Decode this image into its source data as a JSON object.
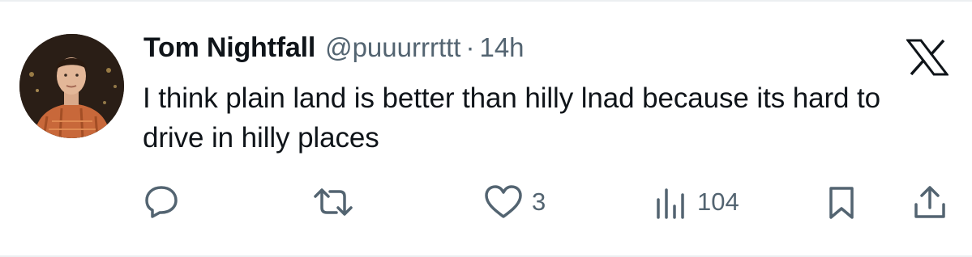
{
  "tweet": {
    "author_name": "Tom Nightfall",
    "handle": "@puuurrrttt",
    "separator": "·",
    "time": "14h",
    "text": "I think plain land is better than hilly lnad because its hard to drive in hilly places"
  },
  "actions": {
    "reply_count": "",
    "retweet_count": "",
    "like_count": "3",
    "views_count": "104"
  },
  "icons": {
    "logo": "x-logo-icon",
    "reply": "speech-bubble-icon",
    "retweet": "retweet-arrows-icon",
    "like": "heart-icon",
    "views": "bar-chart-icon",
    "bookmark": "bookmark-icon",
    "share": "share-upload-icon"
  },
  "colors": {
    "text_primary": "#0f1419",
    "text_secondary": "#536471",
    "divider": "#eceff1"
  }
}
